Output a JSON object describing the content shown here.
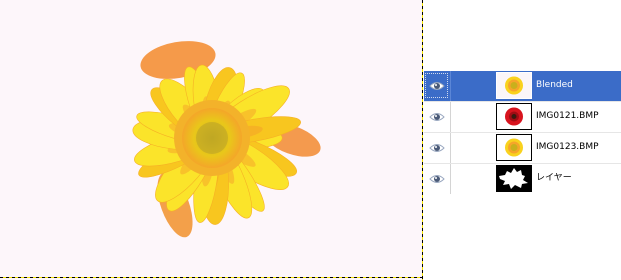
{
  "image_canvas": {
    "background": "#fdf6fa",
    "subject": "yellow-orange-flower"
  },
  "layers": [
    {
      "name": "Blended",
      "visible": true,
      "selected": true,
      "thumbnail": "yellow-flower"
    },
    {
      "name": "IMG0121.BMP",
      "visible": true,
      "selected": false,
      "thumbnail": "red-flower"
    },
    {
      "name": "IMG0123.BMP",
      "visible": true,
      "selected": false,
      "thumbnail": "yellow-flower"
    },
    {
      "name": "レイヤー",
      "visible": true,
      "selected": false,
      "thumbnail": "black-mask"
    }
  ],
  "colors": {
    "selection_highlight": "#3b6cc8",
    "petal_yellow": "#f7e31c",
    "petal_orange": "#f59a2a",
    "center": "#d9c21a"
  },
  "icons": {
    "visibility": "eye-icon"
  }
}
